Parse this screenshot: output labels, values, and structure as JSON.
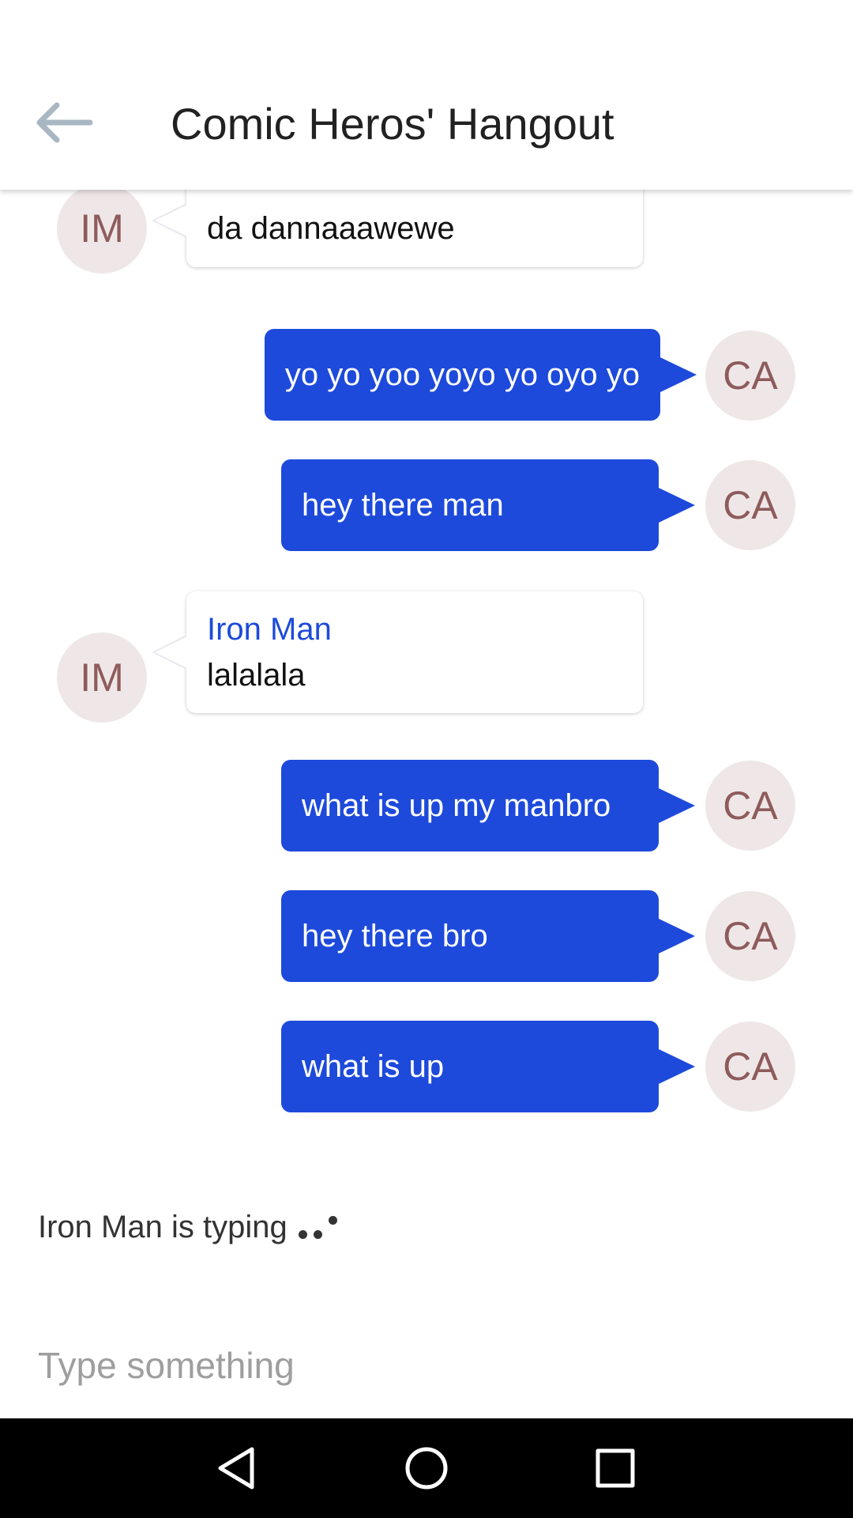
{
  "header": {
    "title": "Comic Heros' Hangout",
    "back_icon": "arrow-left-icon"
  },
  "messages": [
    {
      "direction": "in",
      "avatar": "IM",
      "sender": "",
      "text": "da dannaaawewe"
    },
    {
      "direction": "out",
      "avatar": "CA",
      "text": "yo yo yoo yoyo yo oyo yo"
    },
    {
      "direction": "out",
      "avatar": "CA",
      "text": "hey there man"
    },
    {
      "direction": "in",
      "avatar": "IM",
      "sender": "Iron Man",
      "text": "lalalala"
    },
    {
      "direction": "out",
      "avatar": "CA",
      "text": "what is up my manbro"
    },
    {
      "direction": "out",
      "avatar": "CA",
      "text": "hey there bro"
    },
    {
      "direction": "out",
      "avatar": "CA",
      "text": "what is up"
    }
  ],
  "typing_indicator": "Iron Man is typing",
  "composer": {
    "placeholder": "Type something"
  },
  "navbar": {
    "back": "nav-back-icon",
    "home": "nav-home-icon",
    "recents": "nav-recents-icon"
  },
  "colors": {
    "accent": "#1d4adb",
    "avatar_bg": "#efe7e7",
    "avatar_text": "#8e5b5b"
  }
}
